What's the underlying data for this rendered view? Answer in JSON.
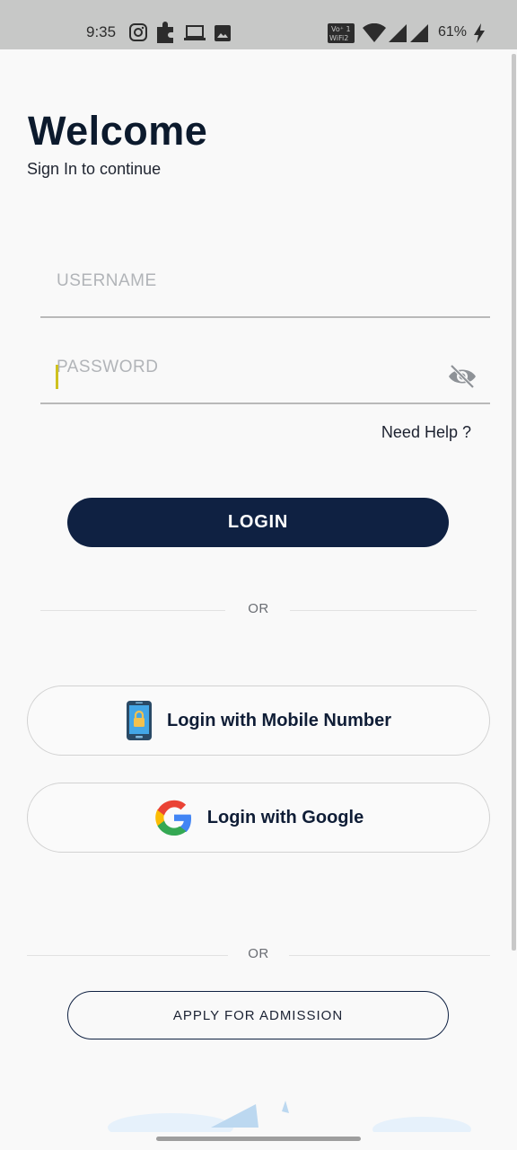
{
  "status_bar": {
    "time": "9:35",
    "battery": "61%",
    "icons": [
      "instagram-icon",
      "extension-icon",
      "laptop-icon",
      "image-icon",
      "vowifi-icon",
      "wifi-icon",
      "signal-icon",
      "signal-icon",
      "charging-icon"
    ]
  },
  "header": {
    "title": "Welcome",
    "subtitle": "Sign In to continue"
  },
  "form": {
    "username_placeholder": "USERNAME",
    "password_placeholder": "PASSWORD",
    "need_help": "Need Help ?",
    "login_label": "LOGIN"
  },
  "divider_1": {
    "text": "OR"
  },
  "alt_logins": {
    "mobile_label": "Login with Mobile Number",
    "google_label": "Login with Google"
  },
  "divider_2": {
    "text": "OR"
  },
  "admission": {
    "label": "APPLY FOR ADMISSION"
  },
  "colors": {
    "primary": "#0f2142",
    "background": "#f9f9f9",
    "status_bar": "#c7c8c7"
  }
}
